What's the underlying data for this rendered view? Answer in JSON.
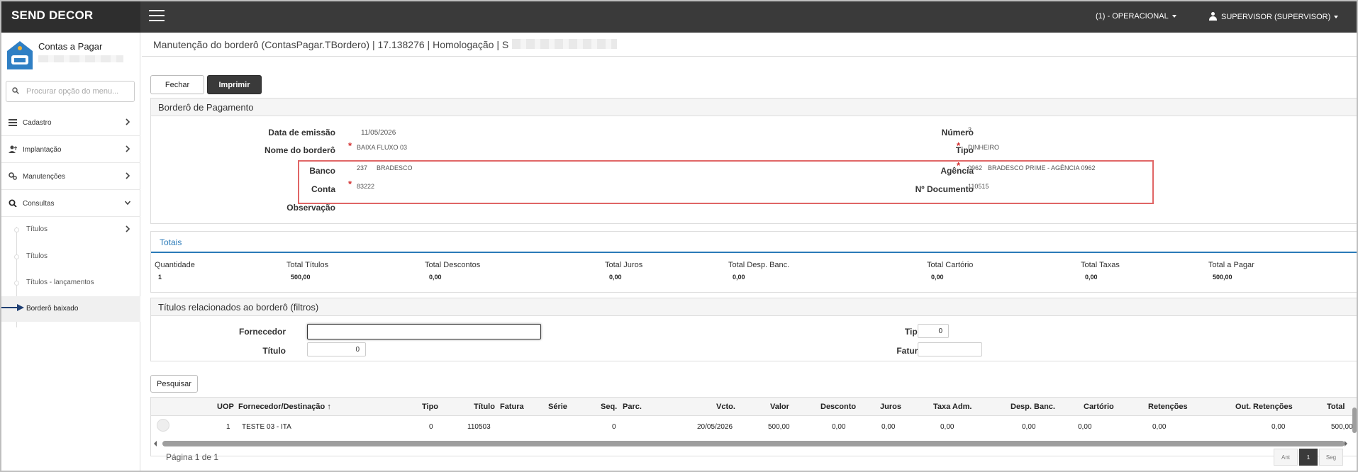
{
  "app": {
    "brand": "SEND DECOR",
    "company": "(1) - OPERACIONAL",
    "user": "SUPERVISOR (SUPERVISOR)"
  },
  "sidebar": {
    "module_title": "Contas a Pagar",
    "search_placeholder": "Procurar opção do menu...",
    "items": [
      {
        "label": "Cadastro",
        "icon": "list-icon"
      },
      {
        "label": "Implantação",
        "icon": "user-upload-icon"
      },
      {
        "label": "Manutenções",
        "icon": "gears-icon"
      },
      {
        "label": "Consultas",
        "icon": "search-icon"
      }
    ],
    "subitems": [
      {
        "label": "Títulos"
      },
      {
        "label": "Títulos"
      },
      {
        "label": "Títulos - lançamentos"
      },
      {
        "label": "Borderô baixado"
      }
    ]
  },
  "page": {
    "title": "Manutenção do borderô (ContasPagar.TBordero) | 17.138276 | Homologação | S",
    "close_label": "Fechar",
    "print_label": "Imprimir"
  },
  "bordero": {
    "section_title": "Borderô de Pagamento",
    "data_emissao_label": "Data de emissão",
    "data_emissao": "11/05/2026",
    "nome_label": "Nome do borderô",
    "nome": "BAIXA FLUXO 03",
    "banco_label": "Banco",
    "banco_code": "237",
    "banco_name": "BRADESCO",
    "conta_label": "Conta",
    "conta": "83222",
    "observacao_label": "Observação",
    "numero_label": "Número",
    "numero": "3",
    "tipo_label": "Tipo",
    "tipo": "DINHEIRO",
    "agencia_label": "Agência",
    "agencia_code": "0962",
    "agencia_name": "BRADESCO PRIME - AGÊNCIA 0962",
    "documento_label": "Nº Documento",
    "documento": "110515"
  },
  "totais": {
    "title": "Totais",
    "items": [
      {
        "label": "Quantidade",
        "value": "1"
      },
      {
        "label": "Total Títulos",
        "value": "500,00"
      },
      {
        "label": "Total Descontos",
        "value": "0,00"
      },
      {
        "label": "Total Juros",
        "value": "0,00"
      },
      {
        "label": "Total Desp. Banc.",
        "value": "0,00"
      },
      {
        "label": "Total Cartório",
        "value": "0,00"
      },
      {
        "label": "Total Taxas",
        "value": "0,00"
      },
      {
        "label": "Total a Pagar",
        "value": "500,00"
      }
    ]
  },
  "filtros": {
    "title": "Títulos relacionados ao borderô (filtros)",
    "fornecedor_label": "Fornecedor",
    "fornecedor": "",
    "titulo_label": "Título",
    "titulo": "0",
    "tipo_label": "Tipo",
    "tipo": "0",
    "fatura_label": "Fatura",
    "fatura": "",
    "search_label": "Pesquisar"
  },
  "table": {
    "columns": [
      "UOP",
      "Fornecedor/Destinação",
      "Tipo",
      "Título",
      "Fatura",
      "Série",
      "Seq.",
      "Parc.",
      "Vcto.",
      "Valor",
      "Desconto",
      "Juros",
      "Taxa Adm.",
      "Desp. Banc.",
      "Cartório",
      "Retenções",
      "Out. Retenções",
      "Total"
    ],
    "sort_indicator": "↑",
    "rows": [
      [
        "1",
        "TESTE 03 - ITA",
        "0",
        "110503",
        "",
        "",
        "0",
        "",
        "20/05/2026",
        "500,00",
        "0,00",
        "0,00",
        "0,00",
        "0,00",
        "0,00",
        "0,00",
        "0,00",
        "500,00"
      ]
    ]
  },
  "pagination": {
    "text": "Página 1 de 1",
    "prev": "Ant",
    "current": "1",
    "next": "Seg"
  }
}
